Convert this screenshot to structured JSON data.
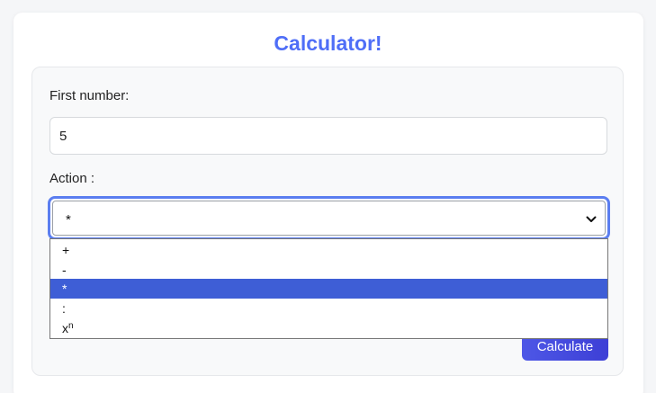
{
  "app": {
    "title": "Calculator!"
  },
  "form": {
    "first_number_label": "First number:",
    "first_number_value": "5",
    "action_label": "Action :",
    "action_selected": "*",
    "action_options": [
      {
        "label": "+",
        "sup": ""
      },
      {
        "label": "-",
        "sup": ""
      },
      {
        "label": "*",
        "sup": ""
      },
      {
        "label": ":",
        "sup": ""
      },
      {
        "label": "x",
        "sup": "n"
      }
    ],
    "selected_index": 2,
    "calculate_label": "Calculate"
  },
  "colors": {
    "accent": "#4f6ef7",
    "selected_option": "#3e5ed6",
    "button": "#4048dd",
    "focus_ring": "#5b7ef0"
  },
  "icons": {
    "select_arrow": "chevron-down-icon"
  }
}
